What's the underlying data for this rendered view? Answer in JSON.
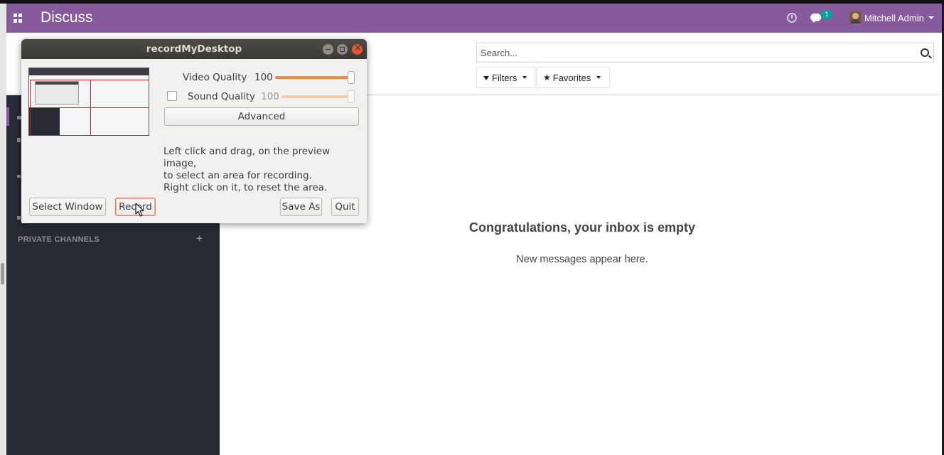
{
  "navbar": {
    "app_title": "Discuss",
    "chat_badge": "1",
    "user_name": "Mitchell Admin",
    "color": "#875a9d"
  },
  "search": {
    "placeholder": "Search..."
  },
  "control_panel": {
    "filters_label": "Filters",
    "favorites_label": "Favorites"
  },
  "sidebar": {
    "private_channels_header": "PRIVATE CHANNELS",
    "add_glyph": "+"
  },
  "empty_state": {
    "title": "Congratulations, your inbox is empty",
    "subtitle": "New messages appear here."
  },
  "dialog": {
    "title": "recordMyDesktop",
    "video_quality_label": "Video Quality",
    "video_quality_value": "100",
    "video_quality_level": 1.0,
    "sound_quality_label": "Sound Quality",
    "sound_quality_value": "100",
    "sound_quality_level": 1.0,
    "sound_enabled": false,
    "advanced_label": "Advanced",
    "help_line1": "Left click and drag, on the preview image,",
    "help_line2": "to select an area for recording.",
    "help_line3": "Right click on it, to reset the area.",
    "select_window_label": "Select Window",
    "record_label": "Record",
    "save_as_label": "Save As",
    "quit_label": "Quit",
    "accent_color": "#f08a4b"
  }
}
